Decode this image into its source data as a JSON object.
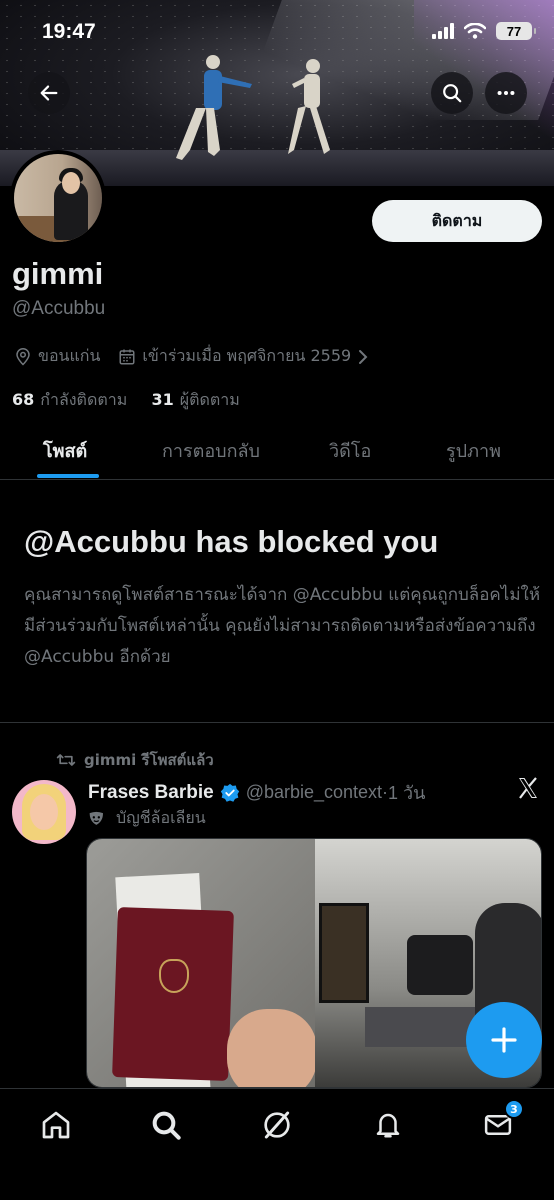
{
  "status_bar": {
    "time": "19:47",
    "battery": "77"
  },
  "profile": {
    "display_name": "gimmi",
    "handle": "@Accubbu",
    "follow_label": "ติดตาม",
    "location": "ขอนแก่น",
    "joined": "เข้าร่วมเมื่อ พฤศจิกายน 2559",
    "following_count": "68",
    "following_label": "กำลังติดตาม",
    "followers_count": "31",
    "followers_label": "ผู้ติดตาม"
  },
  "tabs": [
    {
      "label": "โพสต์",
      "active": true
    },
    {
      "label": "การตอบกลับ",
      "active": false
    },
    {
      "label": "วิดีโอ",
      "active": false
    },
    {
      "label": "รูปภาพ",
      "active": false
    }
  ],
  "blocked": {
    "title": "@Accubbu has blocked you",
    "body": "คุณสามารถดูโพสต์สาธารณะได้จาก @Accubbu แต่คุณถูกบล็อคไม่ให้มีส่วนร่วมกับโพสต์เหล่านั้น คุณยังไม่สามารถติดตามหรือส่งข้อความถึง @Accubbu อีกด้วย"
  },
  "post": {
    "repost_text": "gimmi รีโพสต์แล้ว",
    "author_name": "Frases Barbie",
    "author_handle": "@barbie_context",
    "time": "1 วัน",
    "parody_label": "บัญชีล้อเลียน"
  },
  "navbar": {
    "messages_badge": "3"
  },
  "colors": {
    "accent": "#1d9bf0",
    "background": "#000000",
    "secondary_text": "#71767b"
  }
}
